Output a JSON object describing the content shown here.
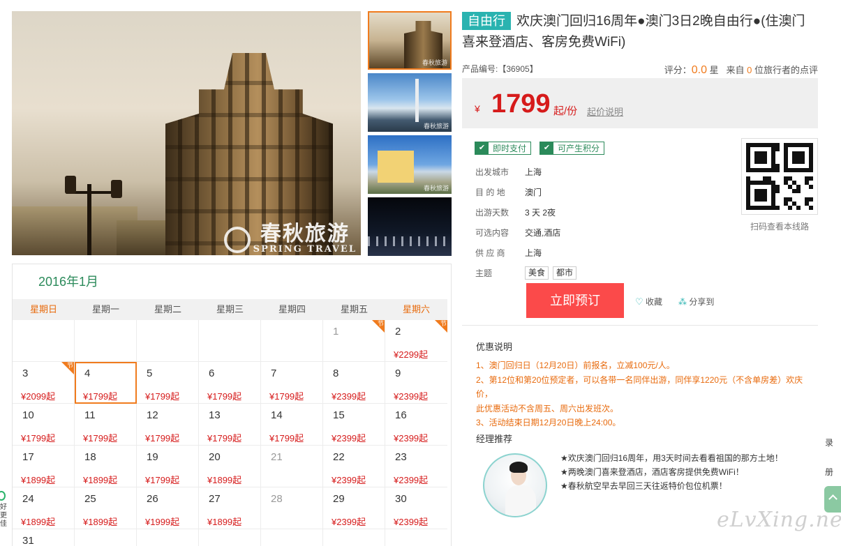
{
  "gallery": {
    "watermark_cn": "春秋旅游",
    "watermark_en": "SPRING TRAVEL",
    "thumb_watermark": "春秋旅游"
  },
  "calendar": {
    "title": "2016年1月",
    "weekdays": [
      "星期日",
      "星期一",
      "星期二",
      "星期三",
      "星期四",
      "星期五",
      "星期六"
    ],
    "festival_mark": "节",
    "weeks": [
      [
        {
          "day": "",
          "price": ""
        },
        {
          "day": "",
          "price": ""
        },
        {
          "day": "",
          "price": ""
        },
        {
          "day": "",
          "price": ""
        },
        {
          "day": "",
          "price": ""
        },
        {
          "day": "1",
          "price": "",
          "muted": true,
          "fest": true
        },
        {
          "day": "2",
          "price": "¥2299起",
          "fest": true
        }
      ],
      [
        {
          "day": "3",
          "price": "¥2099起",
          "fest": true
        },
        {
          "day": "4",
          "price": "¥1799起",
          "selected": true
        },
        {
          "day": "5",
          "price": "¥1799起"
        },
        {
          "day": "6",
          "price": "¥1799起"
        },
        {
          "day": "7",
          "price": "¥1799起"
        },
        {
          "day": "8",
          "price": "¥2399起"
        },
        {
          "day": "9",
          "price": "¥2399起"
        }
      ],
      [
        {
          "day": "10",
          "price": "¥1799起"
        },
        {
          "day": "11",
          "price": "¥1799起"
        },
        {
          "day": "12",
          "price": "¥1799起"
        },
        {
          "day": "13",
          "price": "¥1799起"
        },
        {
          "day": "14",
          "price": "¥1799起"
        },
        {
          "day": "15",
          "price": "¥2399起"
        },
        {
          "day": "16",
          "price": "¥2399起"
        }
      ],
      [
        {
          "day": "17",
          "price": "¥1899起"
        },
        {
          "day": "18",
          "price": "¥1899起"
        },
        {
          "day": "19",
          "price": "¥1799起"
        },
        {
          "day": "20",
          "price": "¥1899起"
        },
        {
          "day": "21",
          "price": "",
          "muted": true
        },
        {
          "day": "22",
          "price": "¥2399起"
        },
        {
          "day": "23",
          "price": "¥2399起"
        }
      ],
      [
        {
          "day": "24",
          "price": "¥1899起"
        },
        {
          "day": "25",
          "price": "¥1899起"
        },
        {
          "day": "26",
          "price": "¥1999起"
        },
        {
          "day": "27",
          "price": "¥1899起"
        },
        {
          "day": "28",
          "price": "",
          "muted": true
        },
        {
          "day": "29",
          "price": "¥2399起"
        },
        {
          "day": "30",
          "price": "¥2399起"
        }
      ],
      [
        {
          "day": "31",
          "price": ""
        },
        {
          "day": "",
          "price": ""
        },
        {
          "day": "",
          "price": ""
        },
        {
          "day": "",
          "price": ""
        },
        {
          "day": "",
          "price": ""
        },
        {
          "day": "",
          "price": ""
        },
        {
          "day": "",
          "price": ""
        }
      ]
    ]
  },
  "product": {
    "tag": "自由行",
    "title": "欢庆澳门回归16周年●澳门3日2晚自由行●(住澳门喜来登酒店、客房免费WiFi)",
    "code_label": "产品编号:【36905】",
    "rating_label": "评分：",
    "rating_score": "0.0",
    "rating_unit": "星",
    "review_prefix": "来自",
    "review_count": "0",
    "review_suffix": "位旅行者的点评"
  },
  "price": {
    "currency": "¥",
    "amount": "1799",
    "unit": "起/份",
    "explain_link": "起价说明"
  },
  "badges": [
    "即时支付",
    "可产生积分"
  ],
  "attributes": [
    {
      "key": "出发城市",
      "value": "上海"
    },
    {
      "key": "目 的 地",
      "value": "澳门"
    },
    {
      "key": "出游天数",
      "value": "3 天 2夜"
    },
    {
      "key": "可选内容",
      "value": "交通,酒店"
    },
    {
      "key": "供 应 商",
      "value": "上海"
    }
  ],
  "theme": {
    "key": "主题",
    "chips": [
      "美食",
      "都市"
    ]
  },
  "qr": {
    "caption": "扫码查看本线路"
  },
  "actions": {
    "book": "立即预订",
    "favorite": "收藏",
    "share": "分享到"
  },
  "promo": {
    "title": "优惠说明",
    "lines": [
      "1、澳门回归日（12月20日）前报名，立减100元/人。",
      "2、第12位和第20位预定者，可以各带一名同伴出游，同伴享1220元（不含单房差）欢庆价，",
      "此优惠活动不含周五、周六出发班次。",
      "3、活动结束日期12月20日晚上24:00。"
    ]
  },
  "manager": {
    "title": "经理推荐",
    "lines": [
      "★欢庆澳门回归16周年，用3天时间去看看祖国的那方土地！",
      "★两晚澳门喜来登酒店，酒店客房提供免费WiFi！",
      "★春秋航空早去早回三天往返特价包位机票！"
    ]
  },
  "side": {
    "char_top": "录",
    "char_mid": "册",
    "left_vert": "好更佳"
  },
  "brand": "eLvXing.net",
  "colors": {
    "accent": "#2ab3b0",
    "price": "#d61b1b",
    "promo": "#e86a0c",
    "selected": "#f07b1d",
    "green": "#2b8a5a"
  }
}
